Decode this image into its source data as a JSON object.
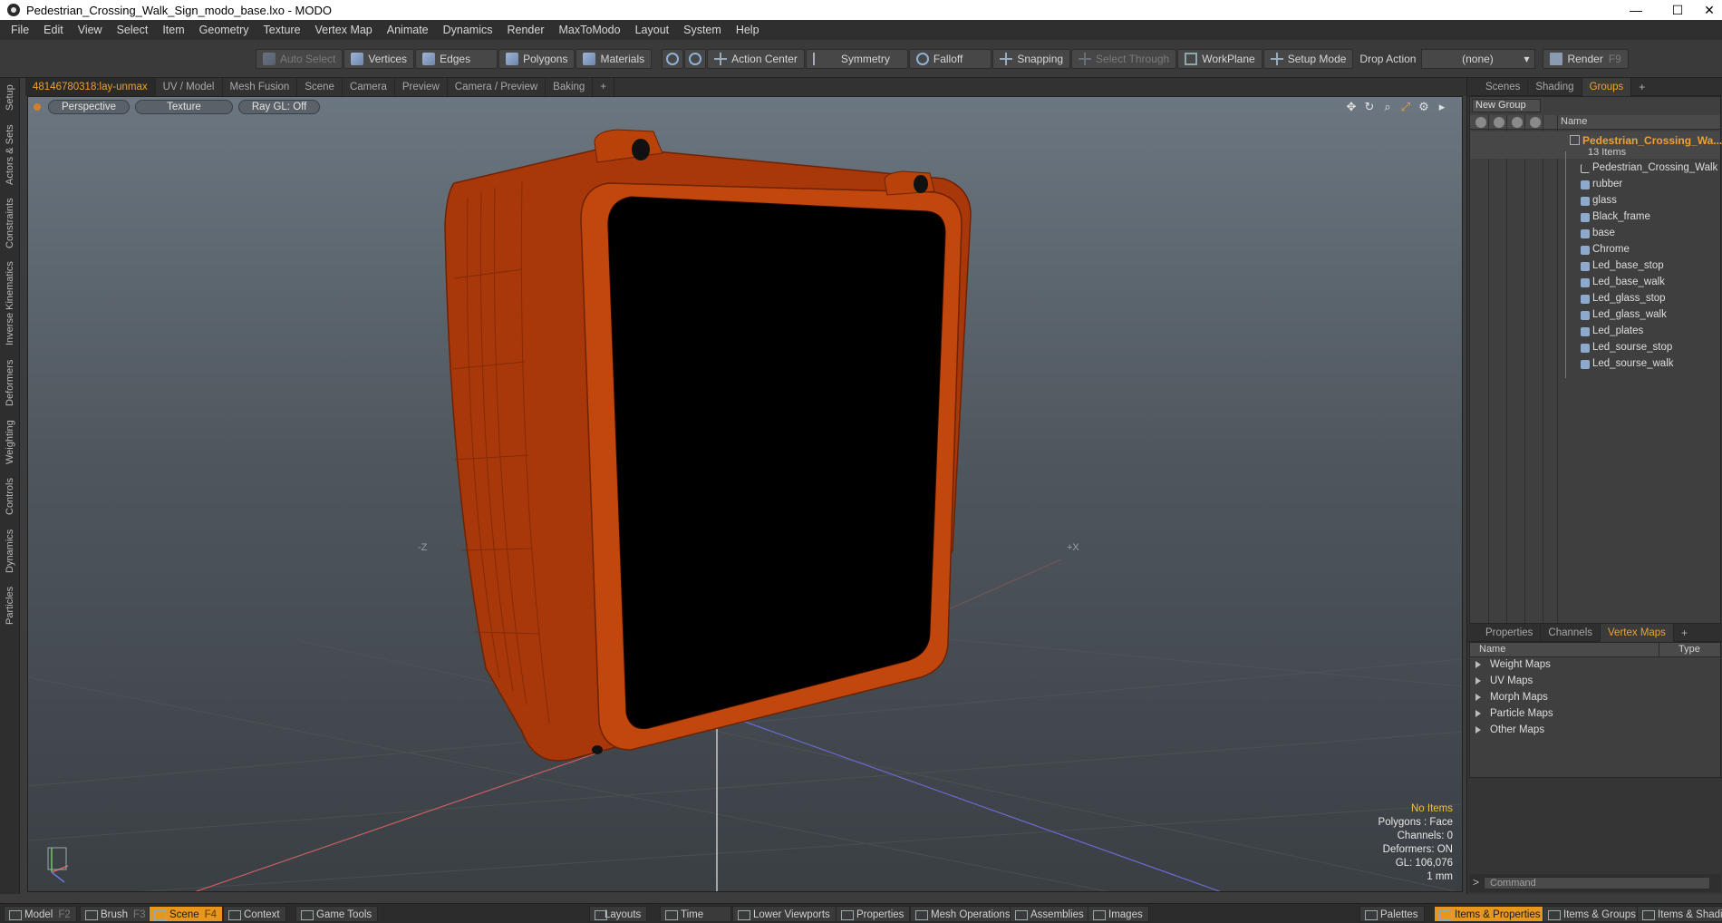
{
  "window": {
    "title": "Pedestrian_Crossing_Walk_Sign_modo_base.lxo - MODO",
    "controls": [
      "—",
      "☐",
      "✕"
    ]
  },
  "menu": [
    "File",
    "Edit",
    "View",
    "Select",
    "Item",
    "Geometry",
    "Texture",
    "Vertex Map",
    "Animate",
    "Dynamics",
    "Render",
    "MaxToModo",
    "Layout",
    "System",
    "Help"
  ],
  "toolbar": {
    "auto_select": "Auto Select",
    "vertices": "Vertices",
    "edges": "Edges",
    "polygons": "Polygons",
    "materials": "Materials",
    "action_center": "Action Center",
    "symmetry": "Symmetry",
    "falloff": "Falloff",
    "snapping": "Snapping",
    "select_through": "Select Through",
    "workplane": "WorkPlane",
    "setup_mode": "Setup Mode",
    "drop_action_label": "Drop Action",
    "drop_action_value": "(none)",
    "render": "Render",
    "render_key": "F9"
  },
  "left_tabs": [
    "Setup",
    "Actors & Sets",
    "Constraints",
    "Inverse Kinematics",
    "Deformers",
    "Weighting",
    "Controls",
    "Dynamics",
    "Particles"
  ],
  "viewport_tabs": [
    "48146780318:lay-unmax",
    "UV / Model",
    "Mesh Fusion",
    "Scene",
    "Camera",
    "Preview",
    "Camera / Preview",
    "Baking",
    "+"
  ],
  "viewport": {
    "view_mode": "Perspective",
    "shading": "Texture",
    "raygl": "Ray GL: Off",
    "axis_z_label": "-Z",
    "axis_x_label": "+X",
    "stats": {
      "selection": "No Items",
      "polygons": "Polygons : Face",
      "channels": "Channels: 0",
      "deformers": "Deformers: ON",
      "gl": "GL: 106,076",
      "unit": "1 mm"
    }
  },
  "right_panel": {
    "top_tabs": [
      "Scenes",
      "Shading",
      "Groups",
      "+"
    ],
    "new_group": "New Group",
    "name_header": "Name",
    "root": {
      "name": "Pedestrian_Crossing_Wa...",
      "count": "13 Items"
    },
    "items": [
      "Pedestrian_Crossing_Walk ...",
      "rubber",
      "glass",
      "Black_frame",
      "base",
      "Chrome",
      "Led_base_stop",
      "Led_base_walk",
      "Led_glass_stop",
      "Led_glass_walk",
      "Led_plates",
      "Led_sourse_stop",
      "Led_sourse_walk"
    ],
    "bottom_tabs": [
      "Properties",
      "Channels",
      "Vertex Maps",
      "+"
    ],
    "vm_name_header": "Name",
    "vm_type_header": "Type",
    "vertex_maps": [
      "Weight Maps",
      "UV Maps",
      "Morph Maps",
      "Particle Maps",
      "Other Maps"
    ],
    "command_placeholder": "Command",
    "command_prompt": ">"
  },
  "bottom_bar": {
    "model": "Model",
    "model_key": "F2",
    "brush": "Brush",
    "brush_key": "F3",
    "scene": "Scene",
    "scene_key": "F4",
    "context": "Context",
    "game_tools": "Game Tools",
    "layouts": "Layouts",
    "time": "Time",
    "lower_viewports": "Lower Viewports",
    "properties": "Properties",
    "mesh_operations": "Mesh Operations",
    "assemblies": "Assemblies",
    "images": "Images",
    "palettes": "Palettes",
    "items_properties": "Items & Properties",
    "items_groups": "Items & Groups",
    "items_shading": "Items & Shadi..."
  },
  "colors": {
    "accent": "#f0a030",
    "model_orange": "#b8420a",
    "screen": "#000000"
  }
}
